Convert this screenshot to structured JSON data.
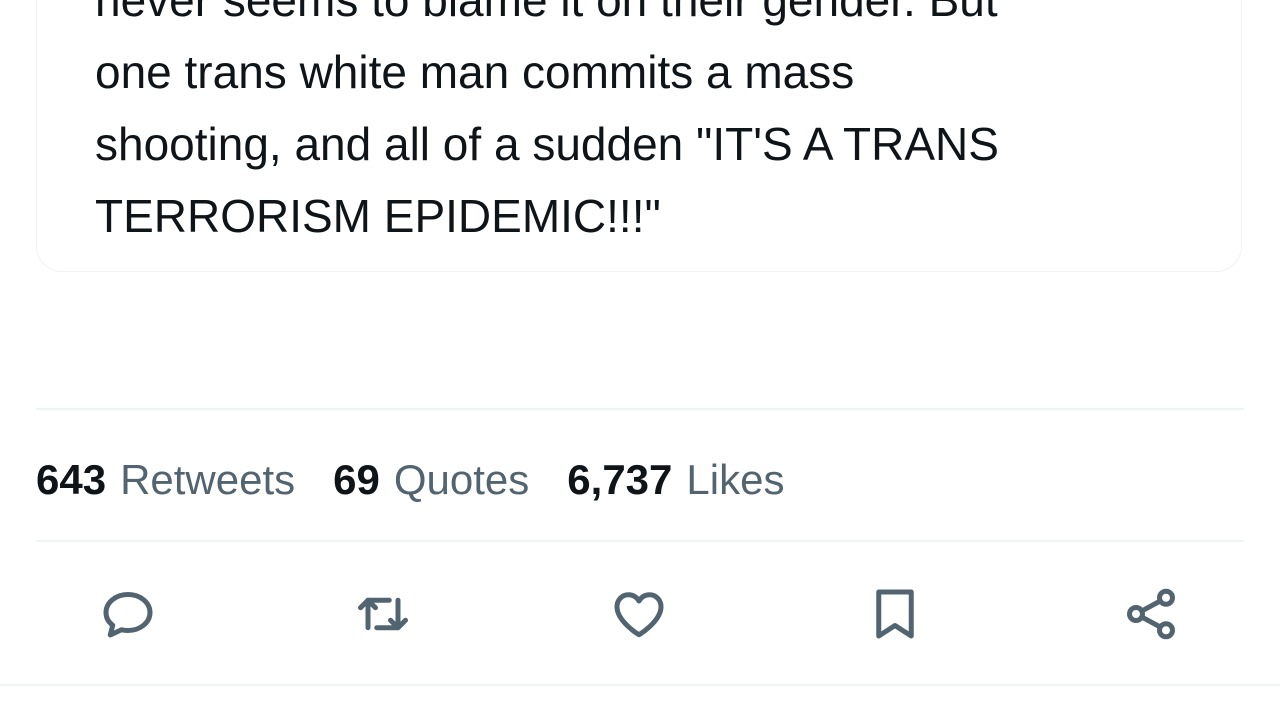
{
  "quoted_tweet": {
    "lines": [
      "never seems to blame it on their gender. But",
      "one trans white man commits a mass",
      "shooting, and all of a sudden \"IT'S A TRANS",
      "TERRORISM EPIDEMIC!!!\""
    ]
  },
  "stats": {
    "retweets": {
      "count": "643",
      "label": "Retweets"
    },
    "quotes": {
      "count": "69",
      "label": "Quotes"
    },
    "likes": {
      "count": "6,737",
      "label": "Likes"
    }
  },
  "actions": [
    {
      "name": "reply",
      "icon": "reply-icon"
    },
    {
      "name": "retweet",
      "icon": "retweet-icon"
    },
    {
      "name": "like",
      "icon": "heart-icon"
    },
    {
      "name": "bookmark",
      "icon": "bookmark-icon"
    },
    {
      "name": "share",
      "icon": "share-icon"
    }
  ],
  "colors": {
    "text_primary": "#0f1419",
    "text_secondary": "#536471",
    "divider": "#eff3f4"
  }
}
